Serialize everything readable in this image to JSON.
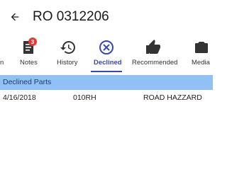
{
  "header": {
    "title": "RO 0312206",
    "back_icon": "arrow-left-icon"
  },
  "tabs": [
    {
      "label": "n",
      "icon": "partial-tab-icon"
    },
    {
      "label": "Notes",
      "icon": "notes-icon",
      "badge": "3"
    },
    {
      "label": "History",
      "icon": "history-icon"
    },
    {
      "label": "Declined",
      "icon": "declined-icon",
      "active": true
    },
    {
      "label": "Recommended",
      "icon": "thumbs-up-icon"
    },
    {
      "label": "Media",
      "icon": "camera-icon"
    }
  ],
  "section": {
    "title": "Declined Parts",
    "color": "#90c0f5"
  },
  "rows": [
    {
      "date": "4/16/2018",
      "code": "010RH",
      "description": "ROAD HAZZARD"
    }
  ],
  "colors": {
    "accent": "#3949ab",
    "badge": "#e53935"
  }
}
